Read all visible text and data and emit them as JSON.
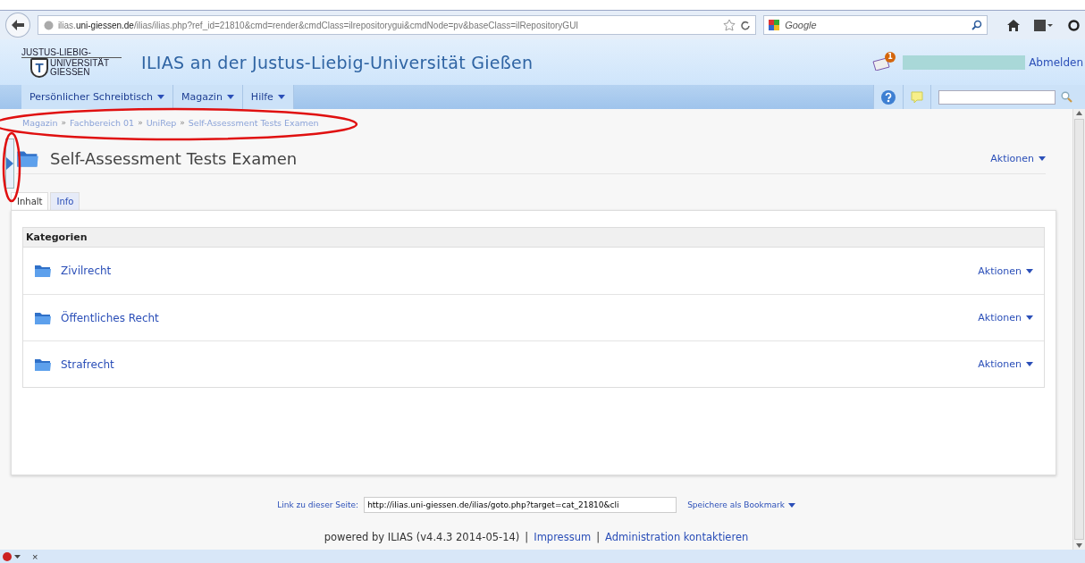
{
  "browser": {
    "url_host": "ilias.",
    "url_domain": "uni-giessen.de",
    "url_path": "/ilias/ilias.php?ref_id=21810&cmd=render&cmdClass=ilrepositorygui&cmdNode=pv&baseClass=ilRepositoryGUI",
    "search_placeholder": "Google"
  },
  "header": {
    "logo_lines": [
      "JUSTUS-LIEBIG-",
      "UNIVERSITÄT",
      "GIESSEN"
    ],
    "emblem_letter": "T",
    "title": "ILIAS an der Justus-Liebig-Universität Gießen",
    "mail_count": "1",
    "logout": "Abmelden"
  },
  "nav": {
    "items": [
      {
        "label": "Persönlicher Schreibtisch"
      },
      {
        "label": "Magazin"
      },
      {
        "label": "Hilfe"
      }
    ]
  },
  "breadcrumb": {
    "separator": "»",
    "items": [
      "Magazin",
      "Fachbereich 01",
      "UniRep",
      "Self-Assessment Tests Examen"
    ]
  },
  "page": {
    "title": "Self-Assessment Tests Examen",
    "actions": "Aktionen"
  },
  "tabs": [
    {
      "label": "Inhalt",
      "selected": true
    },
    {
      "label": "Info",
      "selected": false
    }
  ],
  "categories": {
    "heading": "Kategorien",
    "items": [
      {
        "name": "Zivilrecht",
        "actions": "Aktionen"
      },
      {
        "name": "Öffentliches Recht",
        "actions": "Aktionen"
      },
      {
        "name": "Strafrecht",
        "actions": "Aktionen"
      }
    ]
  },
  "footer": {
    "link_label": "Link zu dieser Seite:",
    "link_value": "http://ilias.uni-giessen.de/ilias/goto.php?target=cat_21810&cli",
    "bookmark": "Speichere als Bookmark",
    "powered": "powered by ILIAS (v4.4.3 2014-05-14)",
    "separator": "|",
    "links": [
      "Impressum",
      "Administration kontaktieren"
    ]
  },
  "addon_bar": {
    "close": "×"
  }
}
